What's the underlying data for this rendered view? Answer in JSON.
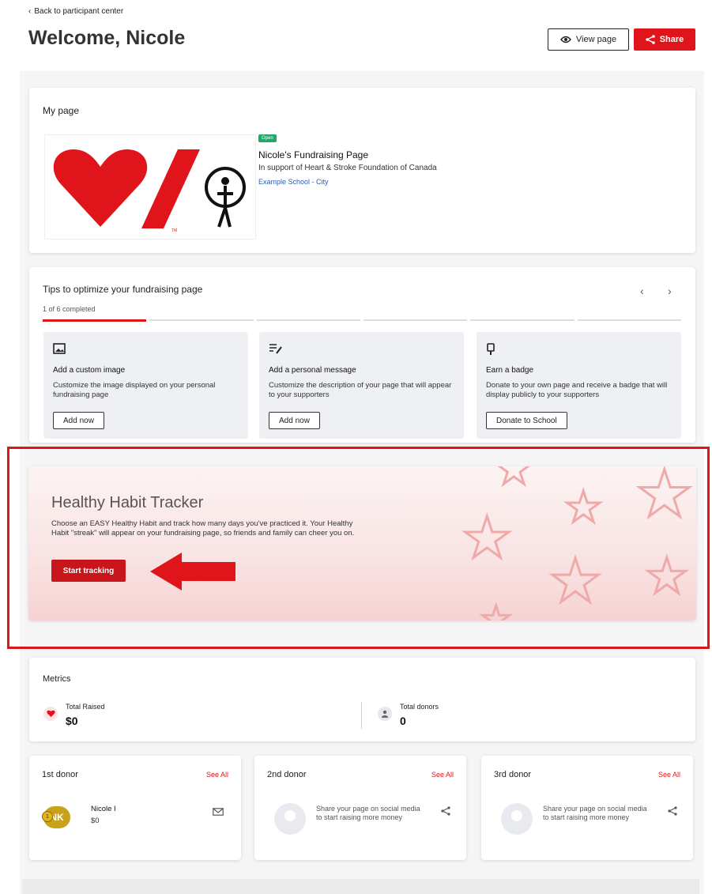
{
  "header": {
    "back_label": "Back to participant center",
    "welcome": "Welcome, Nicole",
    "view_page_label": "View page",
    "share_label": "Share"
  },
  "my_page": {
    "title": "My page",
    "status_badge": "Open",
    "page_name": "Nicole's Fundraising Page",
    "support_text": "In support of Heart & Stroke Foundation of Canada",
    "school_link": "Example School - City",
    "logo_icons": [
      "heart-icon",
      "slash-icon",
      "jump-rope-icon"
    ]
  },
  "tips": {
    "title": "Tips to optimize your fundraising page",
    "progress": "1 of 6 completed",
    "completed": 1,
    "total": 6,
    "items": [
      {
        "icon": "image-icon",
        "title": "Add a custom image",
        "description": "Customize the image displayed on your personal fundraising page",
        "button": "Add now"
      },
      {
        "icon": "edit-text-icon",
        "title": "Add a personal message",
        "description": "Customize the description of your page that will appear to your supporters",
        "button": "Add now"
      },
      {
        "icon": "badge-icon",
        "title": "Earn a badge",
        "description": "Donate to your own page and receive a badge that will display publicly to your supporters",
        "button": "Donate to School"
      }
    ]
  },
  "habit": {
    "title": "Healthy Habit Tracker",
    "description": "Choose an EASY Healthy Habit and track how many days you've practiced it. Your Healthy Habit \"streak\" will appear on your fundraising page, so friends and family can cheer you on.",
    "button": "Start tracking"
  },
  "metrics": {
    "title": "Metrics",
    "total_raised_label": "Total Raised",
    "total_raised_value": "$0",
    "total_donors_label": "Total donors",
    "total_donors_value": "0"
  },
  "donors": [
    {
      "title": "1st donor",
      "see_all": "See All",
      "name": "Nicole I",
      "amount": "$0",
      "initials": "NK",
      "rank": "1"
    },
    {
      "title": "2nd donor",
      "see_all": "See All",
      "empty_text": "Share your page on social media to start raising more money"
    },
    {
      "title": "3rd donor",
      "see_all": "See All",
      "empty_text": "Share your page on social media to start raising more money"
    }
  ],
  "colors": {
    "accent": "#e0141b",
    "open_badge": "#1fa86a",
    "link": "#2a5fb5"
  }
}
